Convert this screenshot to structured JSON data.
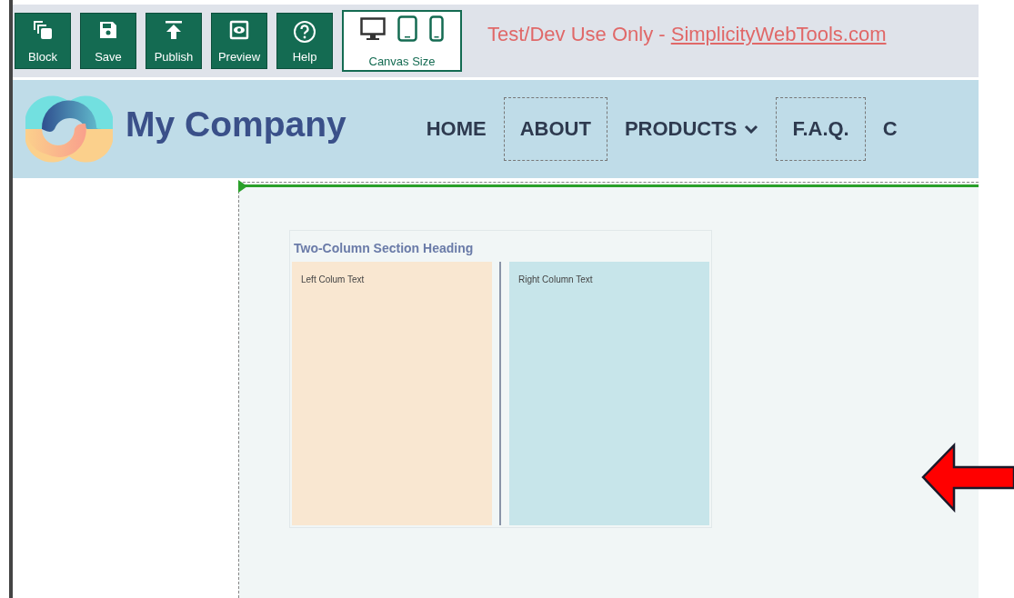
{
  "toolbar": {
    "buttons": [
      {
        "label": "Block",
        "kind": "block"
      },
      {
        "label": "Save",
        "kind": "save"
      },
      {
        "label": "Publish",
        "kind": "publish"
      },
      {
        "label": "Preview",
        "kind": "preview"
      },
      {
        "label": "Help",
        "kind": "help"
      }
    ],
    "canvas_size": {
      "label": "Canvas Size"
    },
    "notice": {
      "text": "Test/Dev Use Only - ",
      "link": "SimplicityWebTools.com"
    }
  },
  "site_header": {
    "company": "My Company",
    "nav": [
      {
        "label": "HOME",
        "kind": "link",
        "outlined": false
      },
      {
        "label": "ABOUT",
        "kind": "link",
        "outlined": true
      },
      {
        "label": "PRODUCTS",
        "kind": "dropdown",
        "outlined": false
      },
      {
        "label": "F.A.Q.",
        "kind": "link",
        "outlined": true
      },
      {
        "label": "C",
        "kind": "link",
        "outlined": false
      }
    ]
  },
  "section": {
    "heading": "Two-Column Section Heading",
    "columns": [
      {
        "text": "Left Colum Text",
        "color": "#f9e7d1"
      },
      {
        "text": "Right Column Text",
        "color": "#c7e5ea"
      }
    ]
  }
}
